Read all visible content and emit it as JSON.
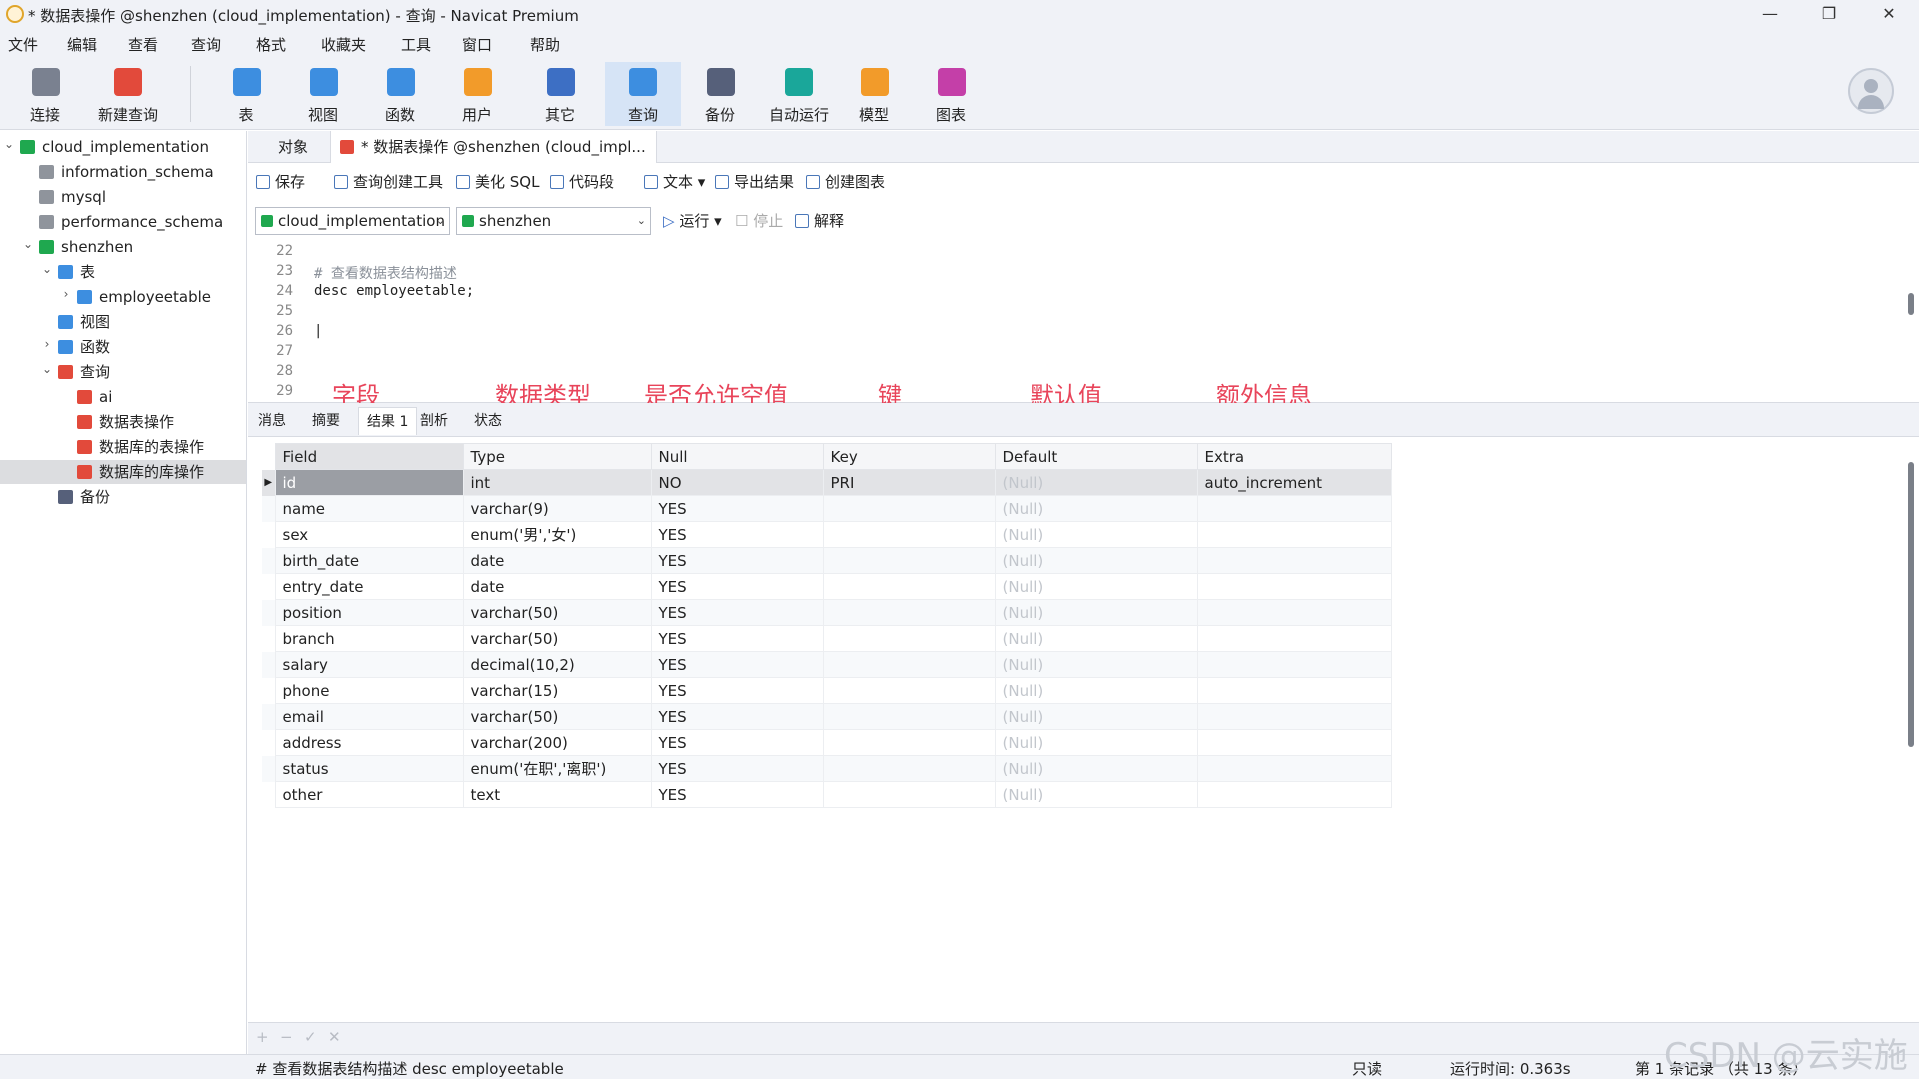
{
  "window": {
    "title": "* 数据表操作 @shenzhen (cloud_implementation) - 查询 - Navicat Premium",
    "min": "—",
    "restore": "❐",
    "close": "✕"
  },
  "menu": [
    "文件",
    "编辑",
    "查看",
    "查询",
    "格式",
    "收藏夹",
    "工具",
    "窗口",
    "帮助"
  ],
  "toolbar": [
    {
      "label": "连接",
      "icon": "plug-icon",
      "color": "#7a8190"
    },
    {
      "label": "新建查询",
      "icon": "new-query-icon",
      "color": "#e24a3b"
    },
    {
      "label": "表",
      "icon": "table-icon",
      "color": "#3d8ee0"
    },
    {
      "label": "视图",
      "icon": "view-icon",
      "color": "#3d8ee0"
    },
    {
      "label": "函数",
      "icon": "function-icon",
      "color": "#3d8ee0"
    },
    {
      "label": "用户",
      "icon": "user-icon",
      "color": "#f29b2a"
    },
    {
      "label": "其它",
      "icon": "tools-icon",
      "color": "#3d6fc4"
    },
    {
      "label": "查询",
      "icon": "query-icon",
      "color": "#3d8ee0"
    },
    {
      "label": "备份",
      "icon": "backup-icon",
      "color": "#56607a"
    },
    {
      "label": "自动运行",
      "icon": "robot-icon",
      "color": "#1aa79a"
    },
    {
      "label": "模型",
      "icon": "model-icon",
      "color": "#f29b2a"
    },
    {
      "label": "图表",
      "icon": "chart-icon",
      "color": "#c43fa8"
    }
  ],
  "sidebar": [
    {
      "label": "cloud_implementation",
      "indent": 0,
      "toggle": "⌄",
      "icon": "#1fa84f"
    },
    {
      "label": "information_schema",
      "indent": 1,
      "toggle": "",
      "icon": "#8f949c"
    },
    {
      "label": "mysql",
      "indent": 1,
      "toggle": "",
      "icon": "#8f949c"
    },
    {
      "label": "performance_schema",
      "indent": 1,
      "toggle": "",
      "icon": "#8f949c"
    },
    {
      "label": "shenzhen",
      "indent": 1,
      "toggle": "⌄",
      "icon": "#1fa84f"
    },
    {
      "label": "表",
      "indent": 2,
      "toggle": "⌄",
      "icon": "#3d8ee0"
    },
    {
      "label": "employeetable",
      "indent": 3,
      "toggle": "›",
      "icon": "#3d8ee0"
    },
    {
      "label": "视图",
      "indent": 2,
      "toggle": "",
      "icon": "#3d8ee0"
    },
    {
      "label": "函数",
      "indent": 2,
      "toggle": "›",
      "icon": "#3d8ee0"
    },
    {
      "label": "查询",
      "indent": 2,
      "toggle": "⌄",
      "icon": "#e24a3b"
    },
    {
      "label": "ai",
      "indent": 3,
      "toggle": "",
      "icon": "#e24a3b"
    },
    {
      "label": "数据表操作",
      "indent": 3,
      "toggle": "",
      "icon": "#e24a3b"
    },
    {
      "label": "数据库的表操作",
      "indent": 3,
      "toggle": "",
      "icon": "#e24a3b"
    },
    {
      "label": "数据库的库操作",
      "indent": 3,
      "toggle": "",
      "icon": "#e24a3b",
      "selected": true
    },
    {
      "label": "备份",
      "indent": 2,
      "toggle": "",
      "icon": "#56607a"
    }
  ],
  "tabs": {
    "objects": "对象",
    "query": "* 数据表操作 @shenzhen (cloud_impl..."
  },
  "editor_toolbar": [
    "保存",
    "查询创建工具",
    "美化 SQL",
    "代码段",
    "文本",
    "导出结果",
    "创建图表"
  ],
  "connection": {
    "db_conn": "cloud_implementation",
    "schema": "shenzhen",
    "run": "运行",
    "stop": "停止",
    "explain": "解释"
  },
  "code_lines": [
    {
      "n": "22",
      "text": ""
    },
    {
      "n": "23",
      "text": "# 查看数据表结构描述"
    },
    {
      "n": "24",
      "text": "desc employeetable;"
    },
    {
      "n": "25",
      "text": ""
    },
    {
      "n": "26",
      "text": "|"
    },
    {
      "n": "27",
      "text": ""
    },
    {
      "n": "28",
      "text": ""
    },
    {
      "n": "29",
      "text": ""
    }
  ],
  "annotations": [
    "字段",
    "数据类型",
    "是否允许空值",
    "键",
    "默认值",
    "额外信息"
  ],
  "result_tabs": [
    "消息",
    "摘要",
    "结果 1",
    "剖析",
    "状态"
  ],
  "result": {
    "columns": [
      "Field",
      "Type",
      "Null",
      "Key",
      "Default",
      "Extra"
    ],
    "rows": [
      [
        "id",
        "int",
        "NO",
        "PRI",
        "(Null)",
        "auto_increment"
      ],
      [
        "name",
        "varchar(9)",
        "YES",
        "",
        "(Null)",
        ""
      ],
      [
        "sex",
        "enum('男','女')",
        "YES",
        "",
        "(Null)",
        ""
      ],
      [
        "birth_date",
        "date",
        "YES",
        "",
        "(Null)",
        ""
      ],
      [
        "entry_date",
        "date",
        "YES",
        "",
        "(Null)",
        ""
      ],
      [
        "position",
        "varchar(50)",
        "YES",
        "",
        "(Null)",
        ""
      ],
      [
        "branch",
        "varchar(50)",
        "YES",
        "",
        "(Null)",
        ""
      ],
      [
        "salary",
        "decimal(10,2)",
        "YES",
        "",
        "(Null)",
        ""
      ],
      [
        "phone",
        "varchar(15)",
        "YES",
        "",
        "(Null)",
        ""
      ],
      [
        "email",
        "varchar(50)",
        "YES",
        "",
        "(Null)",
        ""
      ],
      [
        "address",
        "varchar(200)",
        "YES",
        "",
        "(Null)",
        ""
      ],
      [
        "status",
        "enum('在职','离职')",
        "YES",
        "",
        "(Null)",
        ""
      ],
      [
        "other",
        "text",
        "YES",
        "",
        "(Null)",
        ""
      ]
    ]
  },
  "grid_footer": [
    "+",
    "−",
    "✓",
    "✕"
  ],
  "status": {
    "sql": "# 查看数据表结构描述 desc employeetable",
    "mode": "只读",
    "time": "运行时间: 0.363s",
    "records": "第 1 条记录 （共 13 条）"
  },
  "watermark": "CSDN @云实施"
}
